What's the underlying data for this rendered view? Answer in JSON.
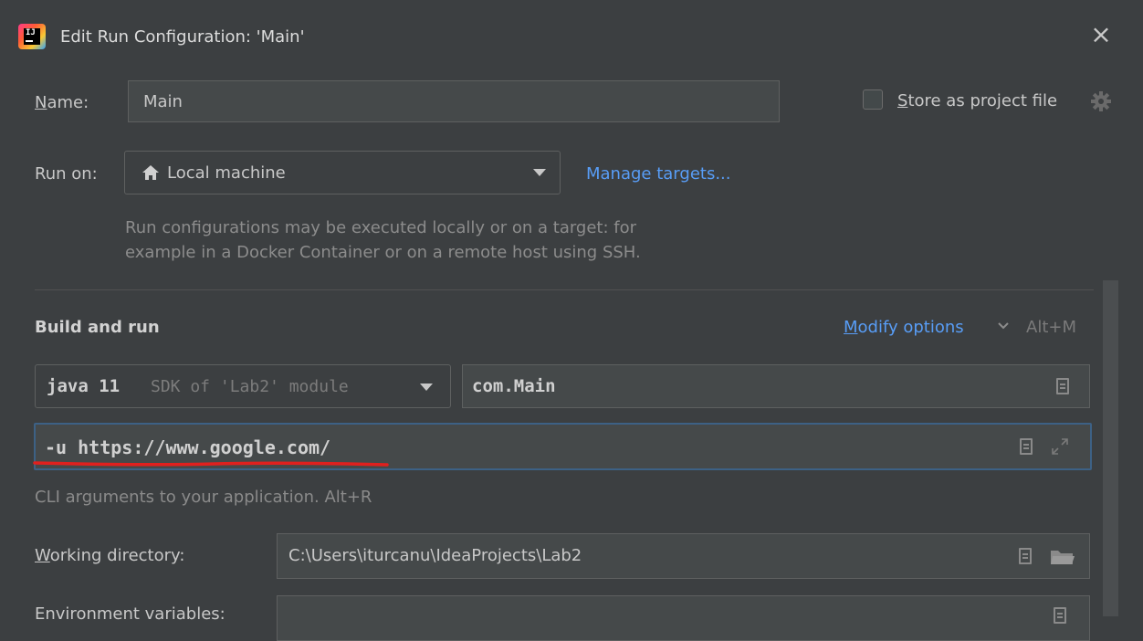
{
  "window": {
    "title": "Edit Run Configuration: 'Main'",
    "close_label": "×"
  },
  "name_row": {
    "label": "Name:",
    "label_mnemonic": "N",
    "label_rest": "ame:",
    "value": "Main",
    "store_label_mnemonic": "S",
    "store_label_rest": "tore as project file",
    "store_checked": false
  },
  "run_on": {
    "label": "Run on:",
    "value": "Local machine",
    "manage_link": "Manage targets...",
    "hint_line1": "Run configurations may be executed locally or on a target: for",
    "hint_line2": "example in a Docker Container or on a remote host using SSH."
  },
  "build_and_run": {
    "title": "Build and run",
    "modify_mnemonic": "M",
    "modify_rest": "odify options",
    "modify_shortcut": "Alt+M",
    "jdk_bold": "java 11",
    "jdk_detail": "SDK of 'Lab2' module",
    "main_class": "com.Main",
    "program_args": "-u https://www.google.com/",
    "program_args_hint": "CLI arguments to your application. Alt+R"
  },
  "working_directory": {
    "label_mnemonic": "W",
    "label_rest": "orking directory:",
    "value": "C:\\Users\\iturcanu\\IdeaProjects\\Lab2"
  },
  "environment_variables": {
    "label": "Environment variables:"
  },
  "colors": {
    "background": "#3c3f41",
    "field_bg": "#45494a",
    "link": "#589df6",
    "focus_border": "#3d6185",
    "annotation": "#e0201e"
  }
}
